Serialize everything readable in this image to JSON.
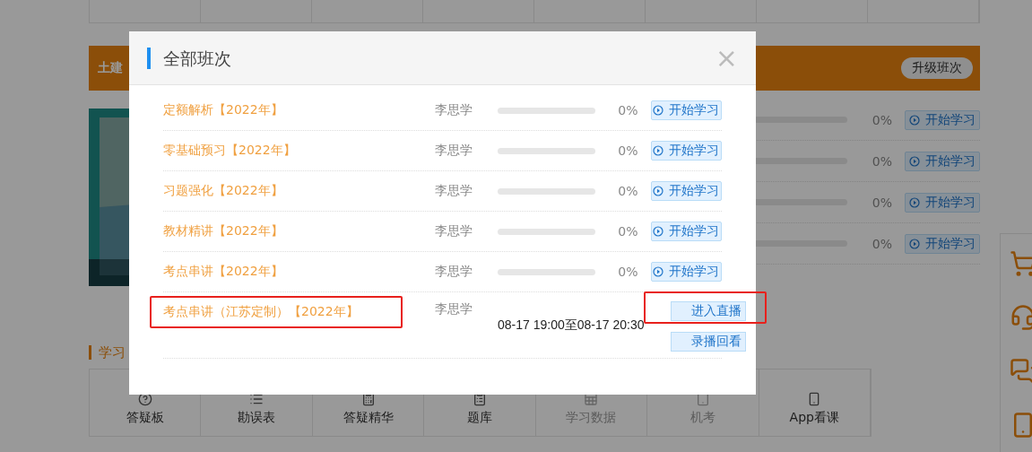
{
  "banner": {
    "title": "土建",
    "button": "升级班次"
  },
  "course_rows": [
    {
      "level": 0,
      "percent": "0%",
      "button": "开始学习"
    },
    {
      "level": 0,
      "percent": "0%",
      "button": "开始学习"
    },
    {
      "level": 0,
      "percent": "0%",
      "button": "开始学习"
    },
    {
      "level": 0,
      "percent": "0%",
      "button": "开始学习"
    }
  ],
  "section_title": "学习",
  "tools": [
    {
      "label": "答疑板",
      "disabled": false
    },
    {
      "label": "勘误表",
      "disabled": false
    },
    {
      "label": "答疑精华",
      "disabled": false
    },
    {
      "label": "题库",
      "disabled": false
    },
    {
      "label": "学习数据",
      "disabled": true
    },
    {
      "label": "机考",
      "disabled": true
    },
    {
      "label": "App看课",
      "disabled": false
    }
  ],
  "dialog": {
    "title": "全部班次",
    "close": "×",
    "rows": [
      {
        "kind": "course",
        "name": "定额解析【2022年】",
        "highlighted": false,
        "teacher": "李思学",
        "level": 0,
        "percent": "0%",
        "button": "开始学习"
      },
      {
        "kind": "course",
        "name": "零基础预习【2022年】",
        "highlighted": false,
        "teacher": "李思学",
        "level": 0,
        "percent": "0%",
        "button": "开始学习"
      },
      {
        "kind": "course",
        "name": "习题强化【2022年】",
        "highlighted": false,
        "teacher": "李思学",
        "level": 0,
        "percent": "0%",
        "button": "开始学习"
      },
      {
        "kind": "course",
        "name": "教材精讲【2022年】",
        "highlighted": false,
        "teacher": "李思学",
        "level": 0,
        "percent": "0%",
        "button": "开始学习"
      },
      {
        "kind": "course",
        "name": "考点串讲【2022年】",
        "highlighted": false,
        "teacher": "李思学",
        "level": 0,
        "percent": "0%",
        "button": "开始学习"
      },
      {
        "kind": "live",
        "name": "考点串讲（江苏定制）【2022年】",
        "highlighted": true,
        "teacher": "李思学",
        "time": "08-17 19:00至08-17 20:30",
        "buttons": [
          {
            "label": "进入直播",
            "highlighted": true
          },
          {
            "label": "录播回看",
            "highlighted": false
          }
        ]
      }
    ]
  }
}
